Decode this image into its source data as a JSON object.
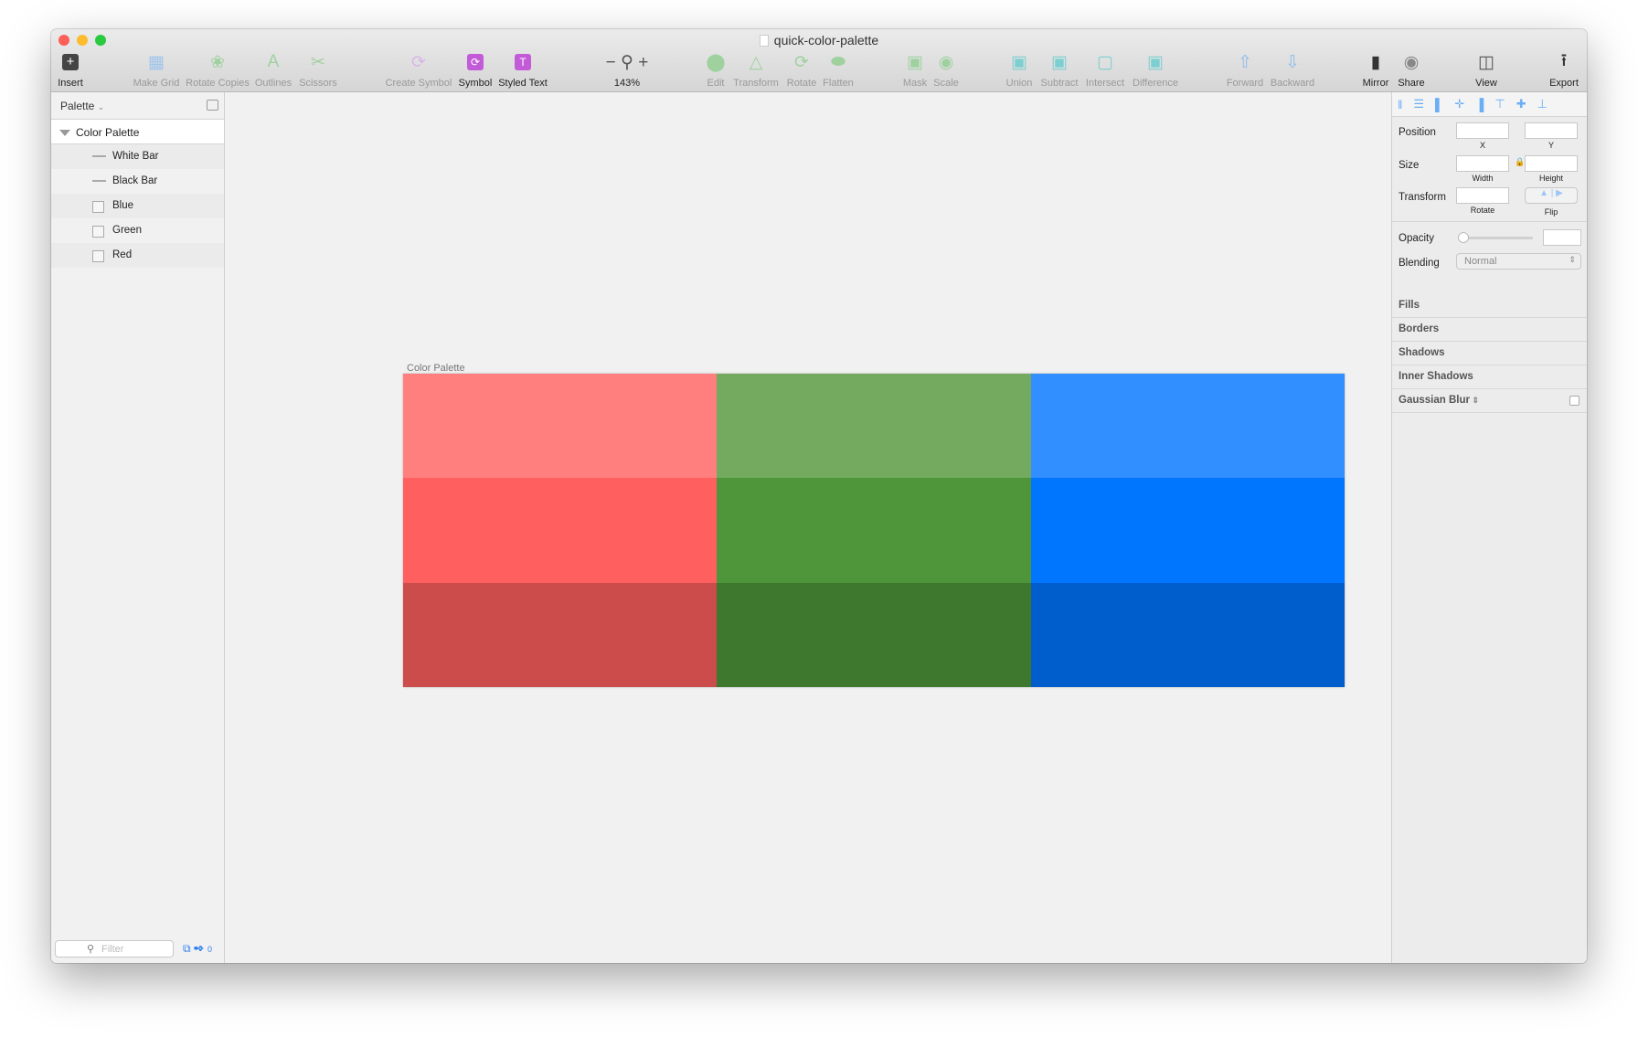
{
  "window": {
    "title": "quick-color-palette"
  },
  "toolbar": [
    {
      "label": "Insert",
      "icon": "plus-icon",
      "active": true
    },
    {
      "label": "Make Grid",
      "icon": "grid-icon"
    },
    {
      "label": "Rotate Copies",
      "icon": "rotate-copies-icon"
    },
    {
      "label": "Outlines",
      "icon": "outlines-icon"
    },
    {
      "label": "Scissors",
      "icon": "scissors-icon"
    },
    {
      "label": "Create Symbol",
      "icon": "create-symbol-icon"
    },
    {
      "label": "Symbol",
      "icon": "symbol-icon",
      "active": true
    },
    {
      "label": "Styled Text",
      "icon": "styled-text-icon",
      "active": true
    },
    {
      "label": "143%",
      "icon": "zoom-icon",
      "active": true
    },
    {
      "label": "Edit",
      "icon": "edit-icon"
    },
    {
      "label": "Transform",
      "icon": "transform-icon"
    },
    {
      "label": "Rotate",
      "icon": "rotate-icon"
    },
    {
      "label": "Flatten",
      "icon": "flatten-icon"
    },
    {
      "label": "Mask",
      "icon": "mask-icon"
    },
    {
      "label": "Scale",
      "icon": "scale-icon"
    },
    {
      "label": "Union",
      "icon": "union-icon"
    },
    {
      "label": "Subtract",
      "icon": "subtract-icon"
    },
    {
      "label": "Intersect",
      "icon": "intersect-icon"
    },
    {
      "label": "Difference",
      "icon": "difference-icon"
    },
    {
      "label": "Forward",
      "icon": "forward-icon"
    },
    {
      "label": "Backward",
      "icon": "backward-icon"
    },
    {
      "label": "Mirror",
      "icon": "mirror-icon",
      "active": true
    },
    {
      "label": "Share",
      "icon": "share-icon",
      "active": true
    },
    {
      "label": "View",
      "icon": "view-icon",
      "active": true
    },
    {
      "label": "Export",
      "icon": "export-icon",
      "active": true
    }
  ],
  "layers": {
    "page": "Palette",
    "group": "Color Palette",
    "items": [
      {
        "name": "White Bar",
        "type": "line"
      },
      {
        "name": "Black Bar",
        "type": "line"
      },
      {
        "name": "Blue",
        "type": "rect"
      },
      {
        "name": "Green",
        "type": "rect"
      },
      {
        "name": "Red",
        "type": "rect"
      }
    ],
    "filter_placeholder": "Filter",
    "count": "0"
  },
  "inspector": {
    "position": "Position",
    "x": "X",
    "y": "Y",
    "size": "Size",
    "width": "Width",
    "height": "Height",
    "transform": "Transform",
    "rotate": "Rotate",
    "flip": "Flip",
    "opacity": "Opacity",
    "opacity_value": 0,
    "blending": "Blending",
    "blending_value": "Normal",
    "sections": [
      "Fills",
      "Borders",
      "Shadows",
      "Inner Shadows",
      "Gaussian Blur"
    ]
  },
  "artboard": {
    "label": "Color Palette",
    "colors": [
      "#FF7F7F",
      "#74AA5F",
      "#328FFF",
      "#FF5F5F",
      "#4F963A",
      "#0076FF",
      "#CC4C4C",
      "#3E772E",
      "#005ECC"
    ]
  }
}
